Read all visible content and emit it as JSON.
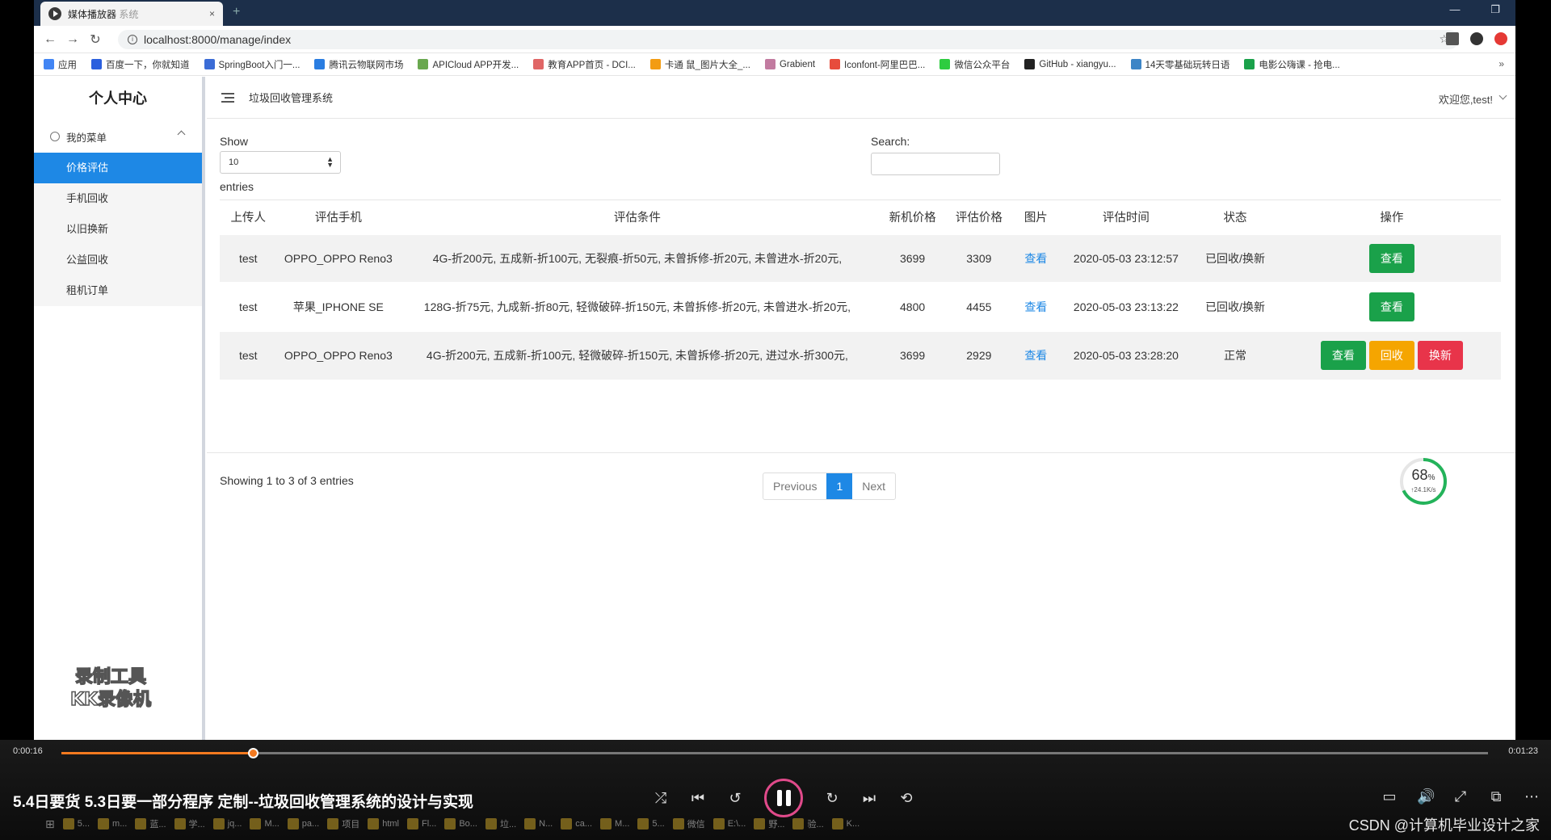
{
  "browser": {
    "tab_title": "媒体播放器",
    "tab_title_suffix": "系统",
    "tab_close": "×",
    "newtab": "+",
    "url": "localhost:8000/manage/index",
    "bookmarks": [
      {
        "label": "应用",
        "color": "#4285f4"
      },
      {
        "label": "百度一下，你就知道",
        "color": "#2b5fde"
      },
      {
        "label": "SpringBoot入门一...",
        "color": "#3b6cd6"
      },
      {
        "label": "腾讯云物联网市场",
        "color": "#2a7de1"
      },
      {
        "label": "APICloud APP开发...",
        "color": "#6aa84f"
      },
      {
        "label": "教育APP首页 - DCI...",
        "color": "#e06666"
      },
      {
        "label": "卡通 鼠_图片大全_...",
        "color": "#f39c12"
      },
      {
        "label": "Grabient",
        "color": "#c27ba0"
      },
      {
        "label": "Iconfont-阿里巴巴...",
        "color": "#e74c3c"
      },
      {
        "label": "微信公众平台",
        "color": "#2ecc40"
      },
      {
        "label": "GitHub - xiangyu...",
        "color": "#222222"
      },
      {
        "label": "14天零基础玩转日语",
        "color": "#3d85c6"
      },
      {
        "label": "电影公嗨课 - 抢电...",
        "color": "#1aa14a"
      }
    ],
    "bookmarks_more": "»"
  },
  "sidebar": {
    "title": "个人中心",
    "group": "我的菜单",
    "items": [
      {
        "label": "价格评估",
        "active": true
      },
      {
        "label": "手机回收"
      },
      {
        "label": "以旧换新"
      },
      {
        "label": "公益回收"
      },
      {
        "label": "租机订单"
      }
    ],
    "watermark_line1": "录制工具",
    "watermark_line2": "KK录像机"
  },
  "header": {
    "system_title": "垃圾回收管理系统",
    "welcome": "欢迎您,test!"
  },
  "datatable": {
    "show_label": "Show",
    "page_size": "10",
    "entries_label": "entries",
    "search_label": "Search:",
    "columns": [
      "上传人",
      "评估手机",
      "评估条件",
      "新机价格",
      "评估价格",
      "图片",
      "评估时间",
      "状态",
      "操作"
    ],
    "rows": [
      {
        "uploader": "test",
        "phone": "OPPO_OPPO Reno3",
        "conditions": "4G-折200元, 五成新-折100元, 无裂痕-折50元, 未曾拆修-折20元, 未曾进水-折20元,",
        "new_price": "3699",
        "eval_price": "3309",
        "image": "查看",
        "time": "2020-05-03 23:12:57",
        "status": "已回收/换新",
        "actions": [
          "查看"
        ]
      },
      {
        "uploader": "test",
        "phone": "苹果_IPHONE SE",
        "conditions": "128G-折75元, 九成新-折80元, 轻微破碎-折150元, 未曾拆修-折20元, 未曾进水-折20元,",
        "new_price": "4800",
        "eval_price": "4455",
        "image": "查看",
        "time": "2020-05-03 23:13:22",
        "status": "已回收/换新",
        "actions": [
          "查看"
        ]
      },
      {
        "uploader": "test",
        "phone": "OPPO_OPPO Reno3",
        "conditions": "4G-折200元, 五成新-折100元, 轻微破碎-折150元, 未曾拆修-折20元, 进过水-折300元,",
        "new_price": "3699",
        "eval_price": "2929",
        "image": "查看",
        "time": "2020-05-03 23:28:20",
        "status": "正常",
        "actions": [
          "查看",
          "回收",
          "换新"
        ]
      }
    ],
    "showing": "Showing 1 to 3 of 3 entries",
    "prev": "Previous",
    "page": "1",
    "next": "Next"
  },
  "speed_widget": {
    "percent": "68",
    "unit": "%",
    "rate": "↑24.1K/s",
    "value": 0.68
  },
  "player": {
    "current_time": "0:00:16",
    "total_time": "0:01:23",
    "progress": 0.135,
    "title": "5.4日要货 5.3日要一部分程序 定制--垃圾回收管理系统的设计与实现"
  },
  "taskbar": {
    "items": [
      "5...",
      "m...",
      "蓝...",
      "学...",
      "jq...",
      "M...",
      "pa...",
      "项目",
      "html",
      "Fl...",
      "Bo...",
      "垃...",
      "N...",
      "ca...",
      "M...",
      "5...",
      "微信",
      "E:\\...",
      "野...",
      "验...",
      "K..."
    ]
  },
  "footer_watermark": "CSDN @计算机毕业设计之家"
}
